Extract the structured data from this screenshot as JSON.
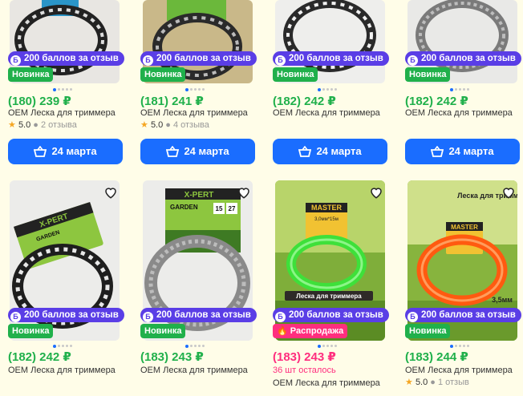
{
  "colors": {
    "accent": "#1a6dff",
    "price": "#20b04b",
    "sale": "#ff2e7e",
    "bonus": "#5a3ee6",
    "bg": "#fffde8"
  },
  "products": [
    {
      "bonus": "200 баллов за отзыв",
      "tag": "Новинка",
      "price": "(180) 239 ₽",
      "title": "OEM Леска для триммера",
      "rating": "5.0",
      "reviews": "2 отзыва",
      "button": "24 марта"
    },
    {
      "bonus": "200 баллов за отзыв",
      "tag": "Новинка",
      "price": "(181) 241 ₽",
      "title": "OEM Леска для триммера",
      "rating": "5.0",
      "reviews": "4 отзыва",
      "button": "24 марта"
    },
    {
      "bonus": "200 баллов за отзыв",
      "tag": "Новинка",
      "price": "(182) 242 ₽",
      "title": "OEM Леска для триммера",
      "button": "24 марта"
    },
    {
      "bonus": "200 баллов за отзыв",
      "tag": "Новинка",
      "price": "(182) 242 ₽",
      "title": "OEM Леска для триммера",
      "button": "24 марта"
    },
    {
      "bonus": "200 баллов за отзыв",
      "tag": "Новинка",
      "price": "(182) 242 ₽",
      "title": "OEM Леска для триммера",
      "image_text": [
        "X-PERT",
        "GARDEN"
      ]
    },
    {
      "bonus": "200 баллов за отзыв",
      "tag": "Новинка",
      "price": "(183) 243 ₽",
      "title": "OEM Леска для триммера",
      "image_text": [
        "X-PERT",
        "GARDEN",
        "15",
        "27"
      ]
    },
    {
      "bonus": "200 баллов за отзыв",
      "tag": "Распродажа",
      "price": "(183) 243 ₽",
      "stock": "36 шт осталось",
      "title": "OEM Леска для триммера",
      "image_text": [
        "MASTER",
        "3,0мм*15м",
        "Леска для триммера"
      ]
    },
    {
      "bonus": "200 баллов за отзыв",
      "tag": "Новинка",
      "price": "(183) 244 ₽",
      "title": "OEM Леска для триммера",
      "rating": "5.0",
      "reviews": "1 отзыв",
      "image_text": [
        "MASTER",
        "Леска для триммера",
        "3,5мм"
      ]
    }
  ]
}
